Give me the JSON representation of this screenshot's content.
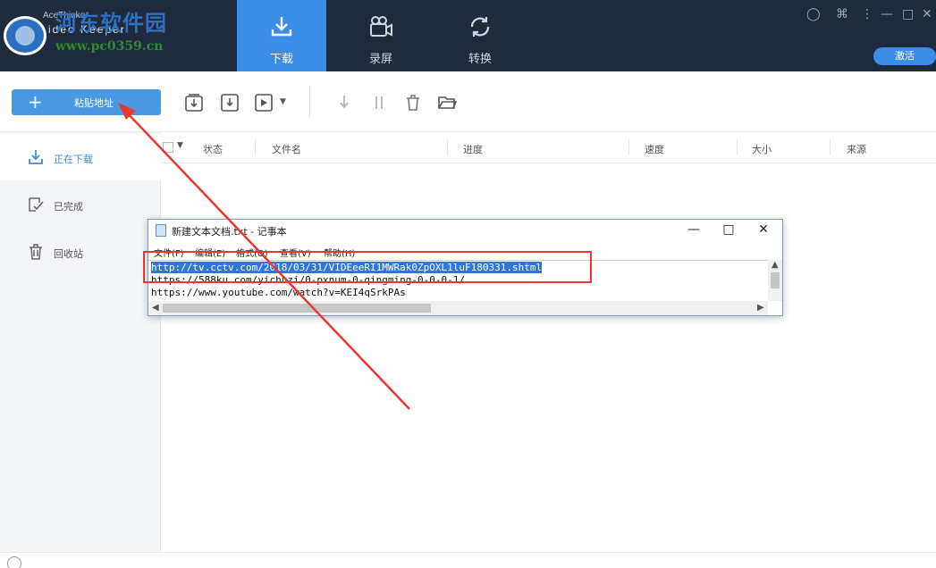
{
  "watermark": {
    "site_name": "河东软件园",
    "url": "www.pc0359.cn"
  },
  "brand": {
    "line1": "AceThinker",
    "line2": "ideo Keeper"
  },
  "nav": {
    "tabs": [
      {
        "label": "下载",
        "icon": "download-icon",
        "active": true
      },
      {
        "label": "录屏",
        "icon": "video-camera-icon",
        "active": false
      },
      {
        "label": "转换",
        "icon": "convert-icon",
        "active": false
      }
    ],
    "activate_label": "激活"
  },
  "toolbar": {
    "paste_label": "粘贴地址"
  },
  "sidebar": {
    "items": [
      {
        "label": "正在下载",
        "icon": "download-icon",
        "active": true
      },
      {
        "label": "已完成",
        "icon": "check-icon",
        "active": false
      },
      {
        "label": "回收站",
        "icon": "trash-icon",
        "active": false
      }
    ]
  },
  "table": {
    "columns": [
      "状态",
      "文件名",
      "进度",
      "速度",
      "大小",
      "来源"
    ]
  },
  "notepad": {
    "title": "新建文本文档.txt - 记事本",
    "menu": [
      "文件(F)",
      "编辑(E)",
      "格式(O)",
      "查看(V)",
      "帮助(H)"
    ],
    "lines": [
      "http://tv.cctv.com/2018/03/31/VIDEeeRI1MWRak0ZpOXL1luF180331.shtml",
      "https://588ku.com/yichuzi/0-pxnum-0-qingming-0-0-0-1/",
      "https://www.youtube.com/watch?v=KEI4qSrkPAs"
    ]
  },
  "colors": {
    "accent": "#3a8ee6",
    "annotation": "#e8382f",
    "topbar": "#1f2a3c"
  }
}
